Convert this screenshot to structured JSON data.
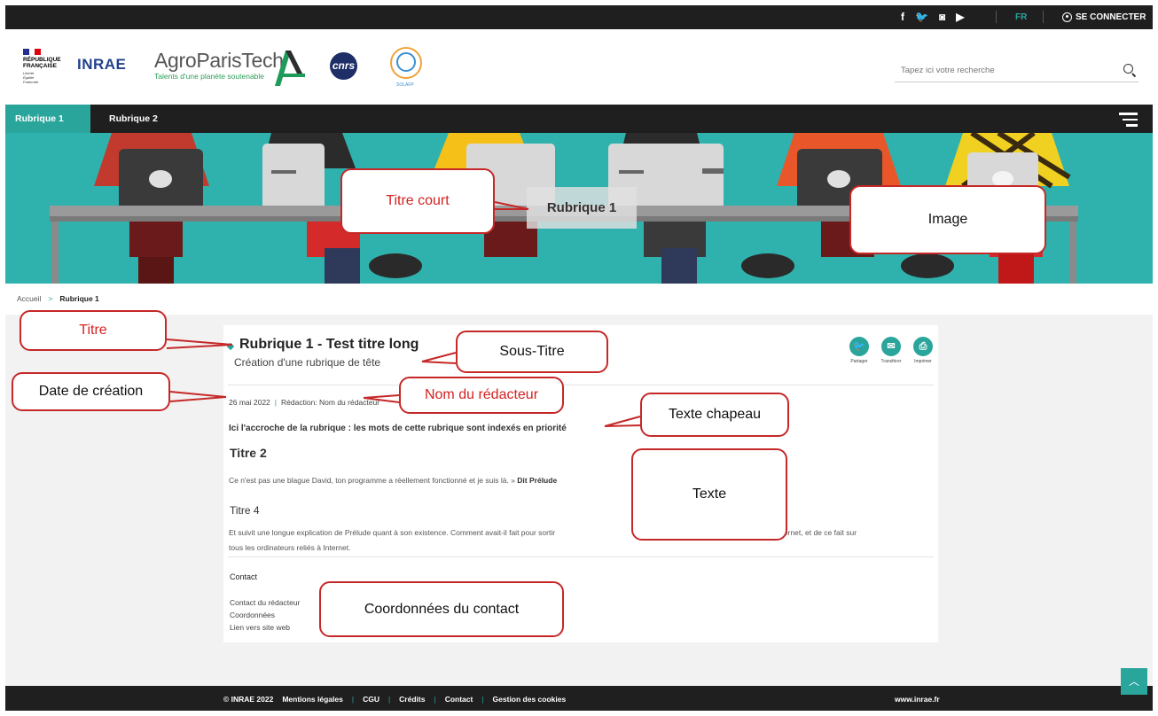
{
  "topbar": {
    "socials": [
      "f",
      "🐦",
      "◙",
      "▶"
    ],
    "lang": "FR",
    "login": "SE CONNECTER"
  },
  "header": {
    "republique": [
      "RÉPUBLIQUE",
      "FRANÇAISE"
    ],
    "motto": [
      "Liberté",
      "Égalité",
      "Fraternité"
    ],
    "inrae": "INRAE",
    "agroparistech_name": "AgroParisTech",
    "agroparistech_tagline": "Talents d'une planète soutenable",
    "cnrs": "cnrs",
    "solafp": "SOLAFP",
    "search_placeholder": "Tapez ici votre recherche"
  },
  "nav": {
    "tab1": "Rubrique 1",
    "tab2": "Rubrique 2"
  },
  "banner": {
    "title": "Rubrique 1"
  },
  "breadcrumb": {
    "home": "Accueil",
    "current": "Rubrique 1"
  },
  "article": {
    "title": "Rubrique 1 - Test titre long",
    "subtitle": "Création d'une rubrique de tête",
    "date": "26 mai 2022",
    "author": "Rédaction: Nom du rédacteur",
    "actions": [
      "Partager",
      "Transférer",
      "Imprimer"
    ],
    "chapeau": "Ici l'accroche de la rubrique : les mots de cette rubrique sont indexés en priorité",
    "h2": "Titre 2",
    "p1": "Ce n'est pas une blague David, ton programme a réellement fonctionné et je suis là. » ",
    "p1_bold": "Dit Prélude",
    "h4": "Titre 4",
    "p2": "Et suivit une longue explication de Prélude quant à son existence. Comment avait-il fait pour sortir",
    "p2_end": "ter sur Internet, et de ce fait sur",
    "p2_line2": "tous les ordinateurs reliés à Internet.",
    "contact_heading": "Contact",
    "contact_lines": [
      "Contact du rédacteur",
      "Coordonnées",
      "Lien vers site web"
    ]
  },
  "annotations": {
    "titre_court": "Titre court",
    "image": "Image",
    "titre": "Titre",
    "sous_titre": "Sous-Titre",
    "date_creation": "Date de création",
    "nom_redacteur": "Nom du rédacteur",
    "texte_chapeau": "Texte chapeau",
    "texte": "Texte",
    "coordonnees": "Coordonnées du contact"
  },
  "footer": {
    "copyright": "© INRAE 2022",
    "links": [
      "Mentions légales",
      "CGU",
      "Crédits",
      "Contact",
      "Gestion des cookies"
    ],
    "site": "www.inrae.fr"
  },
  "colors": {
    "accent": "#2aa59c",
    "dark": "#1f1f1f",
    "annotation_border": "#c62828"
  }
}
